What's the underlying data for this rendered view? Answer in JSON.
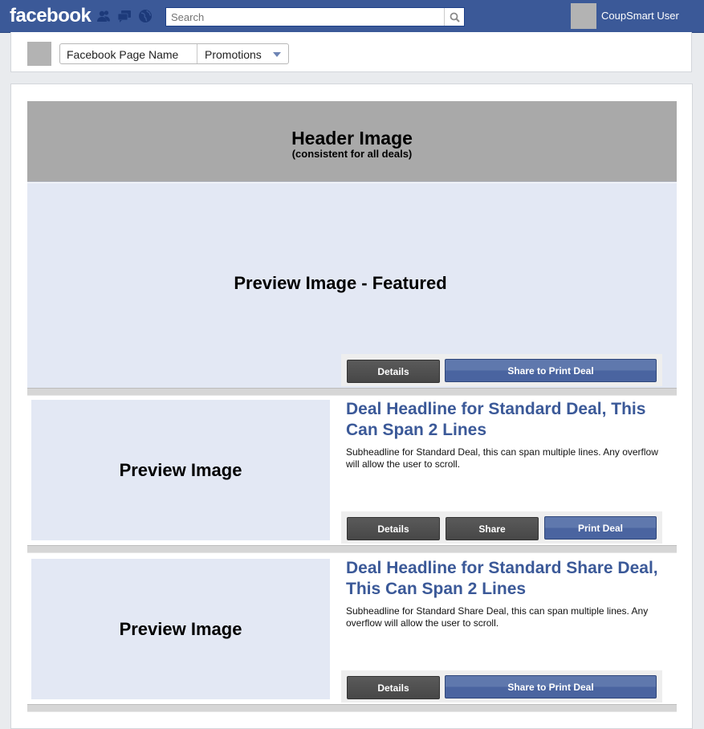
{
  "topbar": {
    "logo": "facebook",
    "search_placeholder": "Search",
    "user_name": "CoupSmart User",
    "icons": [
      "friends-icon",
      "messages-icon",
      "notifications-globe-icon",
      "search-icon"
    ]
  },
  "pagebar": {
    "page_name": "Facebook Page Name",
    "section": "Promotions"
  },
  "header": {
    "title": "Header Image",
    "subtitle": "(consistent for all deals)"
  },
  "featured": {
    "label": "Preview Image - Featured",
    "details_label": "Details",
    "action_label": "Share to Print Deal"
  },
  "deals": [
    {
      "preview_label": "Preview Image",
      "headline": "Deal Headline for Standard Deal, This Can Span 2 Lines",
      "subheadline": "Subheadline for Standard Deal, this can span multiple lines. Any overflow will allow the user to scroll.",
      "details_label": "Details",
      "share_label": "Share",
      "print_label": "Print Deal"
    },
    {
      "preview_label": "Preview Image",
      "headline": "Deal Headline for Standard Share Deal, This Can Span 2 Lines",
      "subheadline": "Subheadline for Standard Share Deal, this can span multiple lines. Any overflow will allow the user to scroll.",
      "details_label": "Details",
      "action_label": "Share to Print Deal"
    }
  ],
  "colors": {
    "brand": "#3b5998",
    "preview_bg": "#e3e8f4",
    "header_bg": "#a9a9a9"
  }
}
